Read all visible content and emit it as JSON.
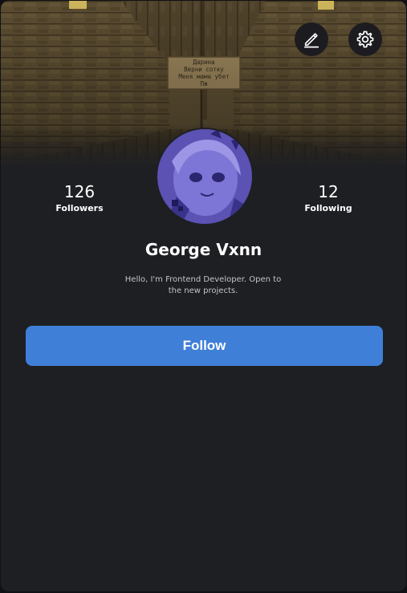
{
  "header": {
    "cover_sign_lines": [
      "Дарина",
      "Верни сотку",
      "Меня мама убет",
      "Пж"
    ],
    "edit_button": {
      "icon": "pencil-icon"
    },
    "settings_button": {
      "icon": "gear-icon"
    }
  },
  "profile": {
    "name": "George Vxnn",
    "bio": "Hello, I'm Frontend Developer. Open to the new projects.",
    "followers": {
      "value": "126",
      "label": "Followers"
    },
    "following": {
      "value": "12",
      "label": "Following"
    },
    "avatar_tint": "#5b52b4"
  },
  "actions": {
    "follow_label": "Follow",
    "follow_color": "#3f7fd8"
  }
}
